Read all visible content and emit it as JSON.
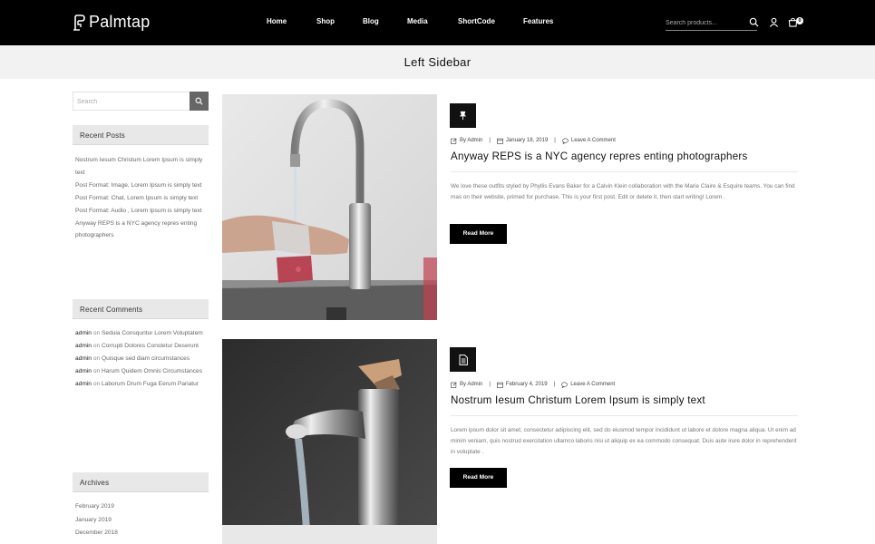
{
  "header": {
    "logo_text": "Palmtap",
    "nav": [
      {
        "label": "Home"
      },
      {
        "label": "Shop"
      },
      {
        "label": "Blog"
      },
      {
        "label": "Media"
      },
      {
        "label": "ShortCode"
      },
      {
        "label": "Features"
      }
    ],
    "search_placeholder": "Search products...",
    "cart_count": "0"
  },
  "page_title": "Left Sidebar",
  "sidebar": {
    "search_placeholder": "Search",
    "recent_posts": {
      "title": "Recent Posts",
      "items": [
        "Nostrum Iesum Christum Lorem Ipsum is simply text",
        "Post Format: Image, Lorem Ipsum is simply text",
        "Post Format: Chat, Lorem Ipsum is simply text",
        "Post Format: Audio , Lorem Ipsum is simply text",
        "Anyway REPS is a NYC agency repres enting photographers"
      ]
    },
    "recent_comments": {
      "title": "Recent Comments",
      "on_word": "on",
      "items": [
        {
          "author": "admin",
          "post": "Seduia Consquntur Lorem Voluptatem"
        },
        {
          "author": "admin",
          "post": "Corrupti Dolores Constetur Deserunt"
        },
        {
          "author": "admin",
          "post": "Quisque sed diam circumstances"
        },
        {
          "author": "admin",
          "post": "Harum Quidem Omnis Circumstances"
        },
        {
          "author": "admin",
          "post": "Laborum Drum Fuga Eerum Pariatur"
        }
      ]
    },
    "archives": {
      "title": "Archives",
      "items": [
        "February 2019",
        "January 2019",
        "December 2018"
      ]
    }
  },
  "posts": [
    {
      "format_icon": "pin-icon",
      "author": "By Admin",
      "date": "January 18, 2019",
      "comments": "Leave A Comment",
      "title": "Anyway REPS is a NYC agency repres enting photographers",
      "excerpt": "We love these outfits styled by Phyllis Evans Baker for a Calvin Klein collaboration with the Marie Claire & Esquire teams. You can find mas on their website, primed for purchase. This is your first post. Edit or delete it, then start writing! Lorem .",
      "read_more": "Read More"
    },
    {
      "format_icon": "document-icon",
      "author": "By Admin",
      "date": "February 4, 2019",
      "comments": "Leave A Comment",
      "title": "Nostrum Iesum Christum Lorem Ipsum is simply text",
      "excerpt": "Lorem ipsum dolor sit amet, consectetur adipiscing elit, sed do eiusmod tempor incididunt ut labore et dolore magna aliqua. Ut enim ad minim veniam, quis nostrud exercitation ullamco laboris nisi ut aliquip ex ea commodo consequat. Duis aute irure dolor in reprehenderit in voluptate .",
      "read_more": "Read More"
    }
  ]
}
